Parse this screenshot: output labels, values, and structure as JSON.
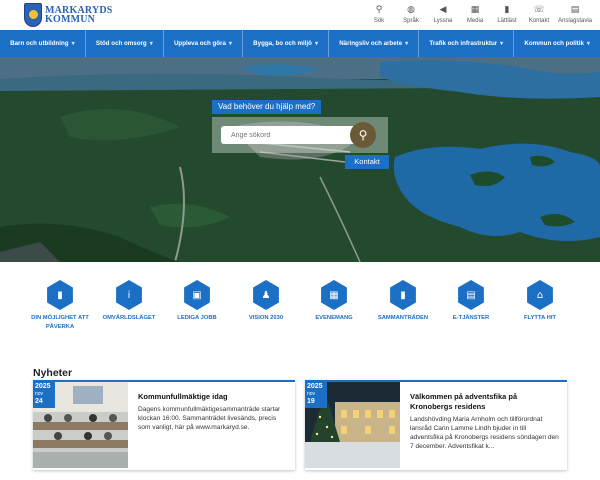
{
  "logo": {
    "line1": "MARKARYDS",
    "line2": "KOMMUN"
  },
  "tools": [
    {
      "icon": "search-icon",
      "glyph": "⚲",
      "label": "Sök"
    },
    {
      "icon": "globe-icon",
      "glyph": "◍",
      "label": "Språk"
    },
    {
      "icon": "speaker-icon",
      "glyph": "◀",
      "label": "Lyssna"
    },
    {
      "icon": "media-icon",
      "glyph": "▦",
      "label": "Media"
    },
    {
      "icon": "readability-icon",
      "glyph": "▮",
      "label": "Lättläst"
    },
    {
      "icon": "contact-icon",
      "glyph": "☏",
      "label": "Kontakt"
    },
    {
      "icon": "noticeboard-icon",
      "glyph": "▤",
      "label": "Anslagstavla"
    }
  ],
  "nav": [
    "Barn och utbildning",
    "Stöd och omsorg",
    "Uppleva och göra",
    "Bygga, bo och miljö",
    "Näringsliv och arbete",
    "Trafik och infrastruktur",
    "Kommun och politik"
  ],
  "hero": {
    "search_title": "Vad behöver du hjälp med?",
    "search_placeholder": "Ange sökord",
    "contact_label": "Kontakt"
  },
  "quick_links": [
    {
      "icon": "document-icon",
      "glyph": "▮",
      "label": "Din möjlighet att påverka"
    },
    {
      "icon": "info-icon",
      "glyph": "i",
      "label": "Omvärldsläget"
    },
    {
      "icon": "briefcase-icon",
      "glyph": "▣",
      "label": "Lediga jobb"
    },
    {
      "icon": "person-icon",
      "glyph": "♟",
      "label": "Vision 2030"
    },
    {
      "icon": "calendar-icon",
      "glyph": "▦",
      "label": "Evenemang"
    },
    {
      "icon": "meeting-document-icon",
      "glyph": "▮",
      "label": "Sammanträden"
    },
    {
      "icon": "eservice-icon",
      "glyph": "▤",
      "label": "E-tjänster"
    },
    {
      "icon": "home-icon",
      "glyph": "⌂",
      "label": "Flytta hit"
    }
  ],
  "news": {
    "heading": "Nyheter",
    "items": [
      {
        "year": "2025",
        "month": "nov",
        "day": "24",
        "title": "Kommunfullmäktige idag",
        "text": "Dagens kommunfullmäktigesammanträde startar klockan 16:00. Sammanträdet livesänds, precis som vanligt, här på www.markaryd.se."
      },
      {
        "year": "2025",
        "month": "nov",
        "day": "19",
        "title": "Välkommen på adventsfika på Kronobergs residens",
        "text": "Landshövding Maria Arnholm och tillförordnat lansråd Carin Lamme Lindh bjuder in till adventsfika på Kronobergs residens söndagen den 7 december. Adventsfikat k..."
      }
    ]
  },
  "colors": {
    "brand": "#1b6fc5",
    "search_button": "#6b5a38"
  }
}
